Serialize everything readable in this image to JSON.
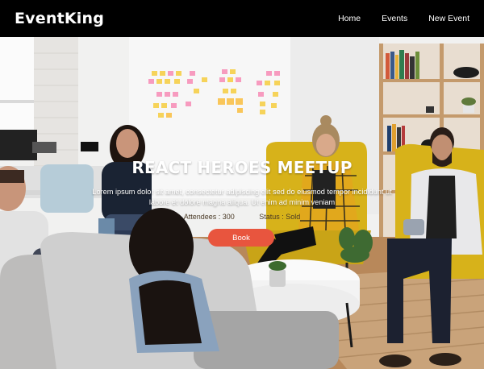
{
  "navbar": {
    "brand": "EventKing",
    "links": [
      {
        "label": "Home"
      },
      {
        "label": "Events"
      },
      {
        "label": "New Event"
      }
    ]
  },
  "hero": {
    "title": "REACT HEROES MEETUP",
    "description": "Lorem ipsum dolor sit amet, consectetur adipiscing elit sed do eiusmod tempor incididunt ut labore et dolore magna aliqua. Ut enim ad minim veniam",
    "attendees": "Attendees : 300",
    "status": "Status : Sold",
    "book_label": "Book"
  },
  "colors": {
    "navbar_bg": "#000000",
    "button_bg": "#e8553e",
    "text_light": "#ffffff"
  }
}
